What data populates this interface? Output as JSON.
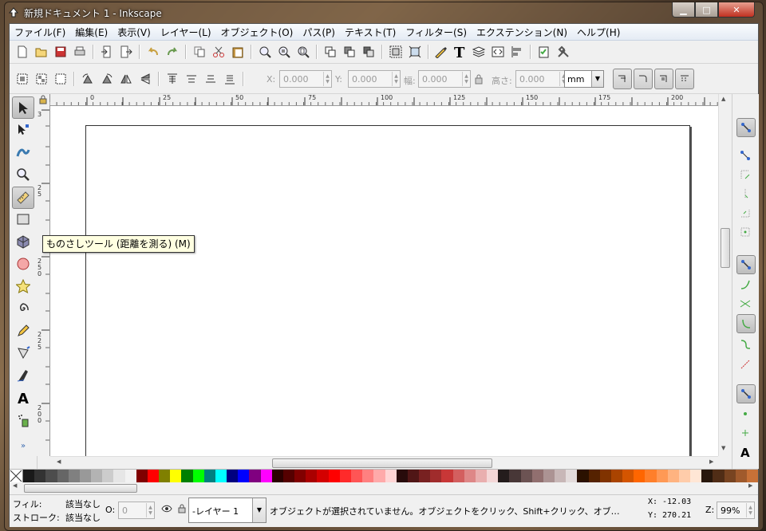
{
  "window": {
    "title": "新規ドキュメント 1 - Inkscape",
    "min_glyph": "▁",
    "max_glyph": "□",
    "close_glyph": "✕"
  },
  "menu": [
    "ファイル(F)",
    "編集(E)",
    "表示(V)",
    "レイヤー(L)",
    "オブジェクト(O)",
    "パス(P)",
    "テキスト(T)",
    "フィルター(S)",
    "エクステンション(N)",
    "ヘルプ(H)"
  ],
  "ctrl": {
    "x_label": "X:",
    "x_value": "0.000",
    "y_label": "Y:",
    "y_value": "0.000",
    "w_label": "幅:",
    "w_value": "0.000",
    "h_label": "高さ:",
    "h_value": "0.000",
    "unit": "mm"
  },
  "ruler_top": [
    "0",
    "25",
    "50",
    "75",
    "100",
    "125",
    "150",
    "175",
    "200"
  ],
  "ruler_left": [
    "3",
    "2 5",
    "2 5 0",
    "2 2 5",
    "2 0 0"
  ],
  "tooltip": "ものさしツール (距離を測る) (M)",
  "status": {
    "fill_label": "フィル:",
    "fill_value": "該当なし",
    "stroke_label": "ストローク:",
    "stroke_value": "該当なし",
    "opacity_label": "O:",
    "opacity_value": "0",
    "layer": "-レイヤー 1",
    "message": "オブジェクトが選択されていません。オブジェクトをクリック、Shift+クリック、オブ…",
    "x_label": "X:",
    "x_value": "-12.03",
    "y_label": "Y:",
    "y_value": "270.21",
    "zoom_label": "Z:",
    "zoom_value": "99%"
  },
  "palette": [
    "#1a1a1a",
    "#333333",
    "#4d4d4d",
    "#666666",
    "#808080",
    "#999999",
    "#b3b3b3",
    "#cccccc",
    "#e6e6e6",
    "#f2f2f2",
    "#800000",
    "#ff0000",
    "#808000",
    "#ffff00",
    "#008000",
    "#00ff00",
    "#008080",
    "#00ffff",
    "#000080",
    "#0000ff",
    "#800080",
    "#ff00ff",
    "#2b0000",
    "#550000",
    "#800000",
    "#aa0000",
    "#d40000",
    "#ff0000",
    "#ff2a2a",
    "#ff5555",
    "#ff8080",
    "#ffaaaa",
    "#ffd5d5",
    "#280b0b",
    "#501616",
    "#782121",
    "#a02c2c",
    "#c83737",
    "#d35f5f",
    "#de8787",
    "#e9afaf",
    "#f4d7d7",
    "#241c1c",
    "#483737",
    "#6c5353",
    "#916f6f",
    "#ac9393",
    "#c8b7b7",
    "#e3dbdb",
    "#2b1100",
    "#552200",
    "#803300",
    "#aa4400",
    "#d45500",
    "#ff6600",
    "#ff7f2a",
    "#ff9955",
    "#ffb380",
    "#ffccaa",
    "#ffe6d5",
    "#28170b",
    "#502d16",
    "#784421",
    "#a05a2c",
    "#c87137"
  ]
}
